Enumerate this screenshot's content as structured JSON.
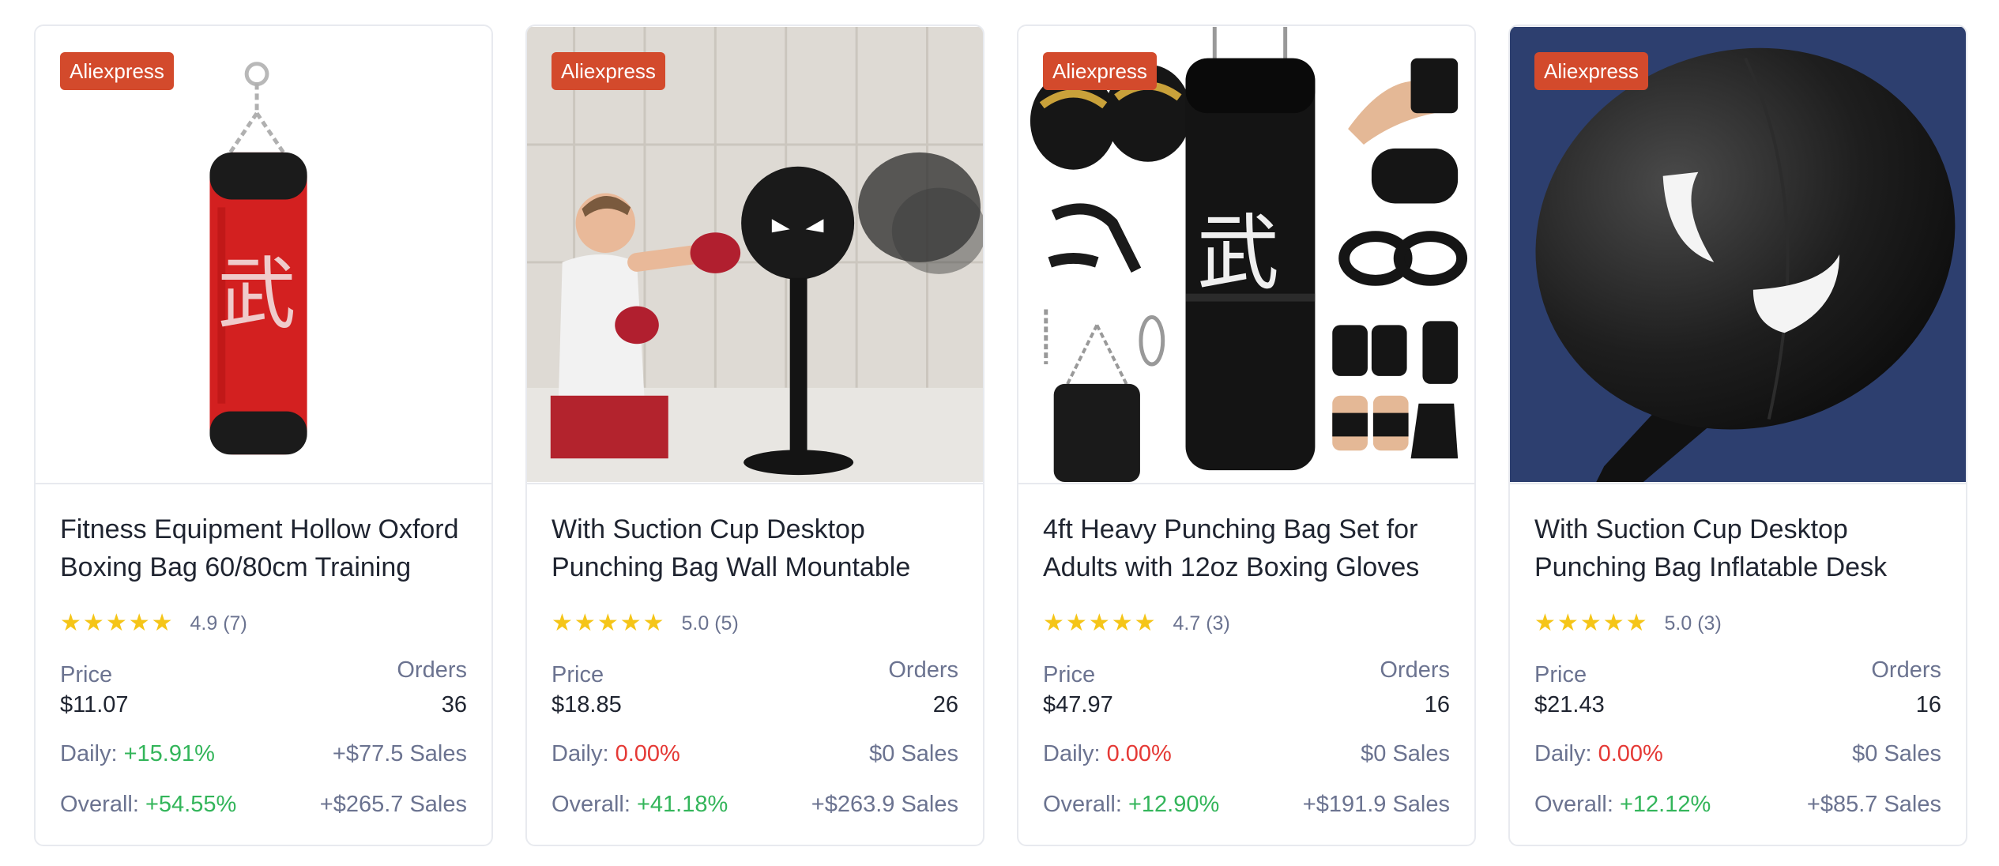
{
  "cards": [
    {
      "badge": "Aliexpress",
      "image_alt": "red-punching-bag",
      "title_line1": "Fitness Equipment Hollow Oxford",
      "title_line2": "Boxing Bag 60/80cm Training",
      "rating": "4.9 (7)",
      "stars": 5,
      "price_label": "Price",
      "price": "$11.07",
      "orders_label": "Orders",
      "orders": "36",
      "daily_label": "Daily:",
      "daily_pct": "+15.91%",
      "daily_trend": "positive",
      "daily_sales": "+$77.5 Sales",
      "overall_label": "Overall:",
      "overall_pct": "+54.55%",
      "overall_trend": "positive",
      "overall_sales": "+$265.7 Sales"
    },
    {
      "badge": "Aliexpress",
      "image_alt": "kid-boxing-desktop-bag",
      "title_line1": "With Suction Cup Desktop",
      "title_line2": "Punching Bag Wall Mountable",
      "rating": "5.0 (5)",
      "stars": 5,
      "price_label": "Price",
      "price": "$18.85",
      "orders_label": "Orders",
      "orders": "26",
      "daily_label": "Daily:",
      "daily_pct": "0.00%",
      "daily_trend": "negative",
      "daily_sales": "$0 Sales",
      "overall_label": "Overall:",
      "overall_pct": "+41.18%",
      "overall_trend": "positive",
      "overall_sales": "+$263.9 Sales"
    },
    {
      "badge": "Aliexpress",
      "image_alt": "heavy-bag-set-with-accessories",
      "title_line1": "4ft Heavy Punching Bag Set for",
      "title_line2": "Adults with 12oz Boxing Gloves",
      "rating": "4.7 (3)",
      "stars": 5,
      "price_label": "Price",
      "price": "$47.97",
      "orders_label": "Orders",
      "orders": "16",
      "daily_label": "Daily:",
      "daily_pct": "0.00%",
      "daily_trend": "negative",
      "daily_sales": "$0 Sales",
      "overall_label": "Overall:",
      "overall_pct": "+12.90%",
      "overall_trend": "positive",
      "overall_sales": "+$191.9 Sales"
    },
    {
      "badge": "Aliexpress",
      "image_alt": "inflatable-desk-bag-closeup",
      "title_line1": "With Suction Cup Desktop",
      "title_line2": "Punching Bag Inflatable Desk",
      "rating": "5.0 (3)",
      "stars": 5,
      "price_label": "Price",
      "price": "$21.43",
      "orders_label": "Orders",
      "orders": "16",
      "daily_label": "Daily:",
      "daily_pct": "0.00%",
      "daily_trend": "negative",
      "daily_sales": "$0 Sales",
      "overall_label": "Overall:",
      "overall_pct": "+12.12%",
      "overall_trend": "positive",
      "overall_sales": "+$85.7 Sales"
    }
  ],
  "colors": {
    "badge": "#d34a2c",
    "positive": "#33b55a",
    "negative": "#e53935",
    "star": "#f5c518",
    "muted": "#6b7390",
    "text": "#1f2430"
  }
}
